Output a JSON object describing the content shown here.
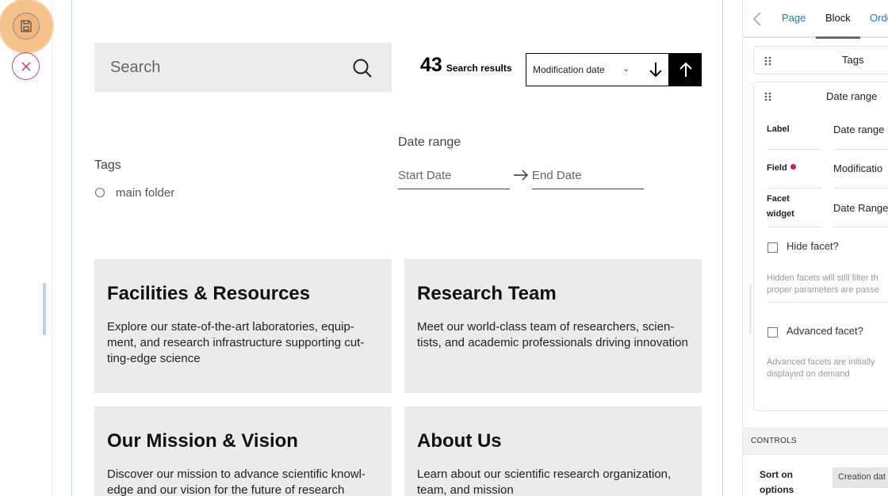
{
  "toolbar": {
    "save_icon": "save-icon",
    "cancel_icon": "close-icon"
  },
  "search": {
    "placeholder": "Search",
    "icon": "search-icon"
  },
  "results": {
    "count": "43",
    "label": "Search results"
  },
  "sort": {
    "selected": "Modification date",
    "direction_down_icon": "arrow-down-icon",
    "direction_up_icon": "arrow-up-icon"
  },
  "facets": {
    "tags": {
      "title": "Tags",
      "options": [
        "main folder"
      ]
    },
    "date_range": {
      "title": "Date range",
      "start_placeholder": "Start Date",
      "end_placeholder": "End Date"
    }
  },
  "cards": [
    {
      "title": "Facilities & Resources",
      "description": "Explore our state-of-the-art laboratories, equip-ment, and research infrastructure supporting cut-ting-edge science"
    },
    {
      "title": "Research Team",
      "description": "Meet our world-class team of researchers, scien-tists, and academic professionals driving innovation"
    },
    {
      "title": "Our Mission & Vision",
      "description": "Discover our mission to advance scientific knowl-edge and our vision for the future of research"
    },
    {
      "title": "About Us",
      "description": "Learn about our scientific research organization, team, and mission"
    }
  ],
  "sidebar": {
    "tabs": [
      "Page",
      "Block",
      "Orde"
    ],
    "active_tab": "Block",
    "facet_tags_title": "Tags",
    "facet_date_title": "Date range",
    "fields": {
      "label": {
        "label": "Label",
        "value": "Date range"
      },
      "field": {
        "label": "Field",
        "value": "Modificatio"
      },
      "widget": {
        "label": "Facet widget",
        "value": "Date Range"
      }
    },
    "hide_facet": {
      "label": "Hide facet?",
      "checked": false,
      "help_line1": "Hidden facets will still filter th",
      "help_line2": "proper parameters are passe"
    },
    "advanced_facet": {
      "label": "Advanced facet?",
      "checked": false,
      "help_line1": "Advanced facets are initially",
      "help_line2": "displayed on demand"
    },
    "controls_title": "CONTROLS",
    "sort_on": {
      "label": "Sort on options",
      "value": "Creation dat"
    }
  }
}
